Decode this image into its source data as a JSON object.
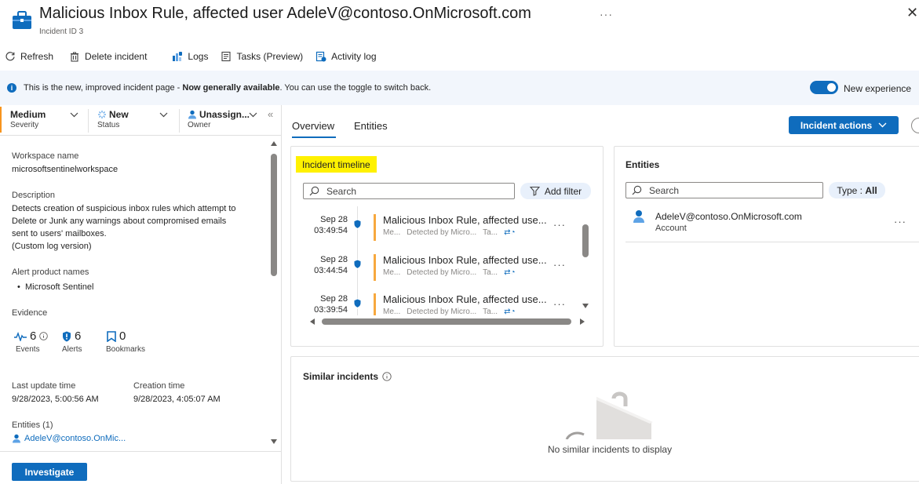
{
  "header": {
    "title": "Malicious Inbox Rule, affected user AdeleV@contoso.OnMicrosoft.com",
    "subtitle": "Incident ID 3",
    "more": "···"
  },
  "toolbar": {
    "refresh": "Refresh",
    "delete": "Delete incident",
    "logs": "Logs",
    "tasks": "Tasks (Preview)",
    "activity": "Activity log"
  },
  "banner": {
    "text_pre": "This is the new, improved incident page - ",
    "text_bold": "Now generally available",
    "text_post": ". You can use the toggle to switch back.",
    "toggle_label": "New experience"
  },
  "status": {
    "severity_value": "Medium",
    "severity_label": "Severity",
    "status_value": "New",
    "status_label": "Status",
    "owner_value": "Unassign...",
    "owner_label": "Owner"
  },
  "details": {
    "workspace_label": "Workspace name",
    "workspace_value": "microsoftsentinelworkspace",
    "description_label": "Description",
    "description_lines": [
      "Detects creation of suspicious inbox rules which attempt to",
      "Delete or Junk any warnings about compromised emails",
      "sent to users' mailboxes.",
      "(Custom log version)"
    ],
    "alert_products_label": "Alert product names",
    "alert_product": "Microsoft Sentinel",
    "evidence_label": "Evidence",
    "events_count": "6",
    "events_label": "Events",
    "alerts_count": "6",
    "alerts_label": "Alerts",
    "bookmarks_count": "0",
    "bookmarks_label": "Bookmarks",
    "last_update_label": "Last update time",
    "last_update_value": "9/28/2023, 5:00:56 AM",
    "creation_label": "Creation time",
    "creation_value": "9/28/2023, 4:05:07 AM",
    "entities_label": "Entities (1)",
    "entity_link": "AdeleV@contoso.OnMic..."
  },
  "investigate_label": "Investigate",
  "tabs": {
    "overview": "Overview",
    "entities": "Entities"
  },
  "incident_actions": "Incident actions",
  "timeline": {
    "heading": "Incident timeline",
    "search_placeholder": "Search",
    "add_filter": "Add filter",
    "items": [
      {
        "date": "Sep 28",
        "time": "03:49:54",
        "title": "Malicious Inbox Rule, affected use...",
        "m1": "Me...",
        "m2": "Detected by Micro...",
        "m3": "Ta..."
      },
      {
        "date": "Sep 28",
        "time": "03:44:54",
        "title": "Malicious Inbox Rule, affected use...",
        "m1": "Me...",
        "m2": "Detected by Micro...",
        "m3": "Ta..."
      },
      {
        "date": "Sep 28",
        "time": "03:39:54",
        "title": "Malicious Inbox Rule, affected use...",
        "m1": "Me...",
        "m2": "Detected by Micro...",
        "m3": "Ta..."
      }
    ]
  },
  "entities_card": {
    "heading": "Entities",
    "search_placeholder": "Search",
    "type_prefix": "Type : ",
    "type_value": "All",
    "entity_name": "AdeleV@contoso.OnMicrosoft.com",
    "entity_type": "Account"
  },
  "similar": {
    "heading": "Similar incidents",
    "empty": "No similar incidents to display"
  },
  "colors": {
    "accent": "#0f6cbd",
    "severity_medium": "#f7941d",
    "highlight": "#fff100"
  }
}
